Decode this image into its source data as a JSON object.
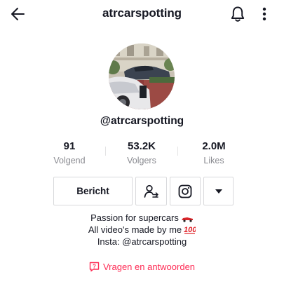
{
  "header": {
    "title": "atrcarspotting",
    "back_icon": "arrow-left-icon",
    "bell_icon": "bell-icon",
    "more_icon": "vertical-dots-icon"
  },
  "profile": {
    "username": "@atrcarspotting",
    "avatar": "car-photo"
  },
  "stats": [
    {
      "value": "91",
      "label": "Volgend"
    },
    {
      "value": "53.2K",
      "label": "Volgers"
    },
    {
      "value": "2.0M",
      "label": "Likes"
    }
  ],
  "actions": {
    "message_label": "Bericht",
    "follow_icon": "add-friend-icon",
    "instagram_icon": "instagram-icon",
    "more_icon": "caret-down-icon"
  },
  "bio": {
    "line1": "Passion for supercars",
    "line2": "All video's made by me",
    "line3": "Insta: @atrcarspotting"
  },
  "qa": {
    "label": "Vragen en antwoorden",
    "icon": "question-bubble-icon"
  },
  "colors": {
    "accent": "#fe2c55",
    "text": "#161823",
    "muted": "#8a8b91",
    "border": "#d8d9dc"
  }
}
